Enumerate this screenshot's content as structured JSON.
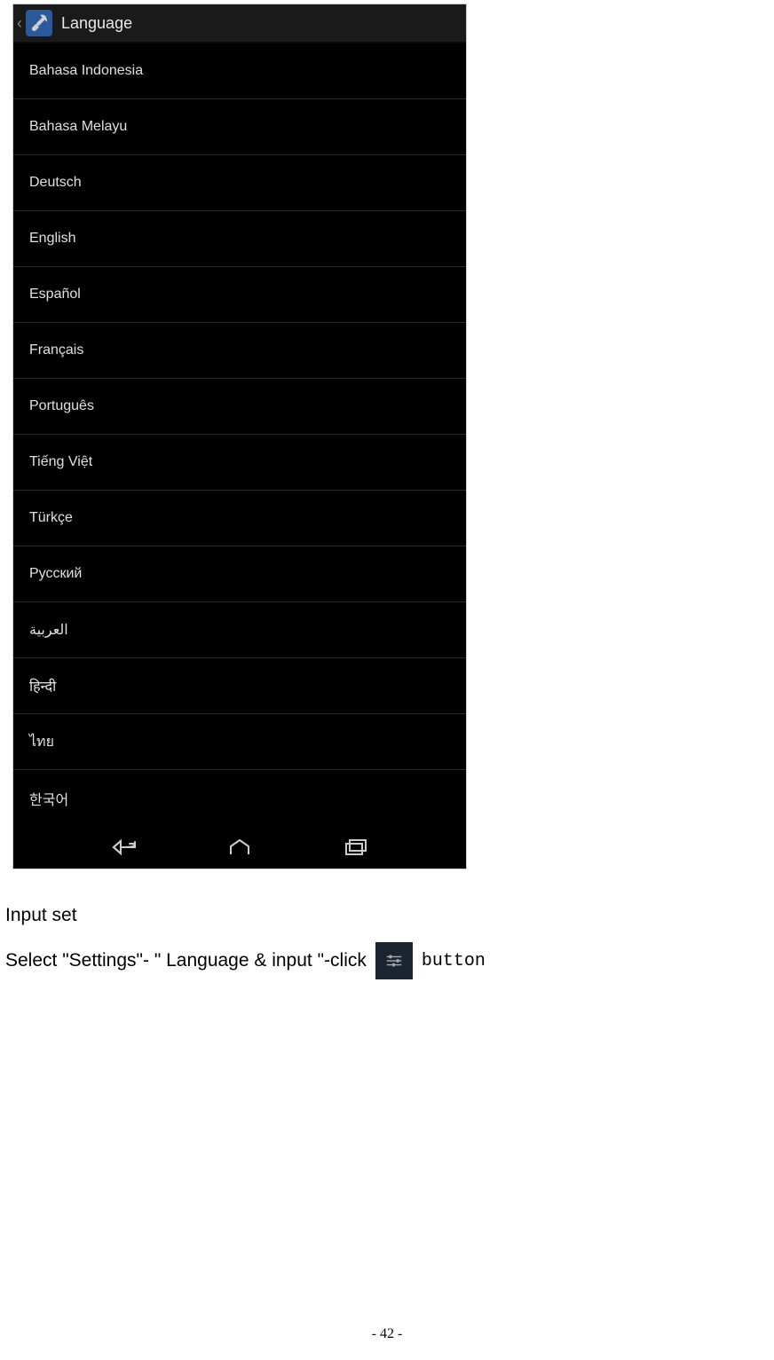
{
  "header": {
    "title": "Language"
  },
  "languages": [
    "Bahasa Indonesia",
    "Bahasa Melayu",
    "Deutsch",
    "English",
    "Español",
    "Français",
    "Português",
    "Tiếng Việt",
    "Türkçe",
    "Русский",
    "العربية",
    "हिन्दी",
    "ไทย",
    "한국어"
  ],
  "doc": {
    "heading": "Input set",
    "instruction": "Select \"Settings\"- \" Language & input \"-click",
    "button_word": "button"
  },
  "page_number": "- 42 -"
}
